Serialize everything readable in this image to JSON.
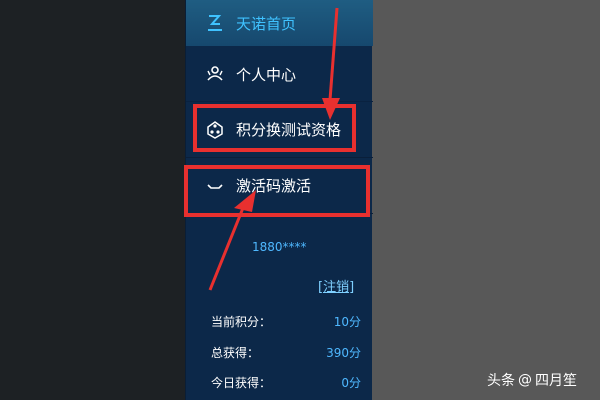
{
  "nav": {
    "home": {
      "label": "天诺首页",
      "icon": "home-icon"
    },
    "personal": {
      "label": "个人中心",
      "icon": "user-center-icon"
    },
    "points": {
      "label": "积分换测试资格",
      "icon": "points-exchange-icon"
    },
    "activate": {
      "label": "激活码激活",
      "icon": "activation-icon"
    }
  },
  "user": {
    "phone": "1880****",
    "logout_label": "[注销]"
  },
  "stats": [
    {
      "label": "当前积分：",
      "value": "10分"
    },
    {
      "label": "总获得：",
      "value": "390分"
    },
    {
      "label": "今日获得：",
      "value": "0分"
    }
  ],
  "watermark": {
    "brand": "头条",
    "separator": "@",
    "author": "四月笙"
  },
  "colors": {
    "sidebar_bg": "#0c2849",
    "active_text": "#3fc2ff",
    "value_text": "#4fb8ff",
    "highlight": "#e8302f"
  }
}
